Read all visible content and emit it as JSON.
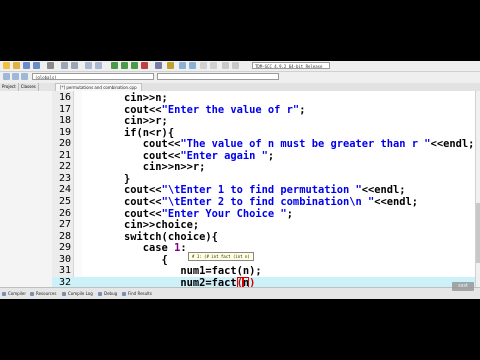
{
  "toolbar": {
    "compiler": "TDM-GCC 4.9.2 64-bit Release",
    "globals": "(globals)"
  },
  "left_tabs": [
    "Project",
    "Classes",
    "Debug"
  ],
  "file_tab": "[*] permutations and combination.cpp",
  "lines": [
    {
      "n": "16",
      "segs": [
        {
          "t": "    cin>>n;"
        }
      ]
    },
    {
      "n": "17",
      "segs": [
        {
          "t": "    cout<<"
        },
        {
          "t": "\"Enter the value of r\"",
          "c": "str"
        },
        {
          "t": ";"
        }
      ]
    },
    {
      "n": "18",
      "segs": [
        {
          "t": "    cin>>r;"
        }
      ]
    },
    {
      "n": "19",
      "segs": [
        {
          "t": "    if(n<r){"
        }
      ]
    },
    {
      "n": "20",
      "segs": [
        {
          "t": "       cout<<"
        },
        {
          "t": "\"The value of n must be greater than r \"",
          "c": "str"
        },
        {
          "t": "<<endl;"
        }
      ]
    },
    {
      "n": "21",
      "segs": [
        {
          "t": "       cout<<"
        },
        {
          "t": "\"Enter again \"",
          "c": "str"
        },
        {
          "t": ";"
        }
      ]
    },
    {
      "n": "22",
      "segs": [
        {
          "t": "       cin>>n>>r;"
        }
      ]
    },
    {
      "n": "23",
      "segs": [
        {
          "t": "    }"
        }
      ]
    },
    {
      "n": "24",
      "segs": [
        {
          "t": "    cout<<"
        },
        {
          "t": "\"\\tEnter 1 to find permutation \"",
          "c": "str"
        },
        {
          "t": "<<endl;"
        }
      ]
    },
    {
      "n": "25",
      "segs": [
        {
          "t": "    cout<<"
        },
        {
          "t": "\"\\tEnter 2 to find combination\\n \"",
          "c": "str"
        },
        {
          "t": "<<endl;"
        }
      ]
    },
    {
      "n": "26",
      "segs": [
        {
          "t": "    cout<<"
        },
        {
          "t": "\"Enter Your Choice \"",
          "c": "str"
        },
        {
          "t": ";"
        }
      ]
    },
    {
      "n": "27",
      "segs": [
        {
          "t": "    cin>>choice;"
        }
      ]
    },
    {
      "n": "28",
      "segs": [
        {
          "t": "    switch(choice){"
        }
      ]
    },
    {
      "n": "29",
      "segs": [
        {
          "t": "       case "
        },
        {
          "t": "1",
          "c": "num"
        },
        {
          "t": ":"
        }
      ]
    },
    {
      "n": "30",
      "segs": [
        {
          "t": "          {"
        }
      ]
    },
    {
      "n": "31",
      "segs": [
        {
          "t": "             num1=fact(n);"
        }
      ]
    },
    {
      "n": "32",
      "segs": [
        {
          "t": "             num2=fact"
        },
        {
          "t": "(",
          "c": "red cur"
        },
        {
          "t": "n",
          "c": "cur"
        },
        {
          "t": ")",
          "c": "red"
        }
      ],
      "highlight": true
    }
  ],
  "tooltip": "# 1: (# int fact (int n)",
  "status_tabs": [
    "Compiler",
    "Resources",
    "Compile Log",
    "Debug",
    "Find Results"
  ],
  "watermark": "ssst"
}
